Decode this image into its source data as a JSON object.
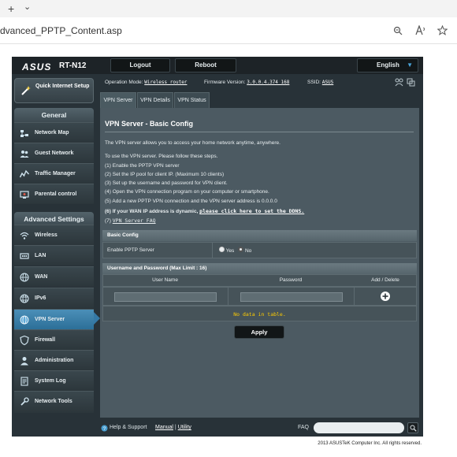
{
  "browser": {
    "url_text": "dvanced_PPTP_Content.asp",
    "new_tab_glyph": "+",
    "dropdown_glyph": "⌄"
  },
  "header": {
    "logo": "ASUS",
    "model": "RT-N12",
    "logout": "Logout",
    "reboot": "Reboot",
    "language": "English"
  },
  "sidebar": {
    "quick_setup": "Quick Internet Setup",
    "general_title": "General",
    "general_items": [
      {
        "label": "Network Map",
        "icon": "network-map-icon"
      },
      {
        "label": "Guest Network",
        "icon": "guest-network-icon"
      },
      {
        "label": "Traffic Manager",
        "icon": "traffic-manager-icon"
      },
      {
        "label": "Parental control",
        "icon": "parental-control-icon"
      }
    ],
    "advanced_title": "Advanced Settings",
    "advanced_items": [
      {
        "label": "Wireless",
        "icon": "wireless-icon"
      },
      {
        "label": "LAN",
        "icon": "lan-icon"
      },
      {
        "label": "WAN",
        "icon": "wan-icon"
      },
      {
        "label": "IPv6",
        "icon": "ipv6-icon"
      },
      {
        "label": "VPN Server",
        "icon": "vpn-server-icon"
      },
      {
        "label": "Firewall",
        "icon": "firewall-icon"
      },
      {
        "label": "Administration",
        "icon": "administration-icon"
      },
      {
        "label": "System Log",
        "icon": "system-log-icon"
      },
      {
        "label": "Network Tools",
        "icon": "network-tools-icon"
      }
    ]
  },
  "status": {
    "op_mode_label": "Operation Mode:",
    "op_mode_value": "Wireless router",
    "firmware_label": "Firmware Version:",
    "firmware_value": "3.0.0.4.374_168",
    "ssid_label": "SSID:",
    "ssid_value": "ASUS"
  },
  "tabs": [
    "VPN Server",
    "VPN Details",
    "VPN Status"
  ],
  "content": {
    "title": "VPN Server - Basic Config",
    "intro": "The VPN server allows you to access your home network anytime, anywhere.",
    "steps_intro": "To use the VPN server. Please follow these steps.",
    "step1": "(1) Enable the PPTP VPN server",
    "step2": "(2) Set the IP pool for client IP. (Maximum 10 clients)",
    "step3": "(3) Set up the username and password for VPN client.",
    "step4": "(4) Open the VPN connection program on your computer or smartphone.",
    "step5": "(5) Add a new PPTP VPN connection and the VPN server address is 0.0.0.0",
    "step6": "(6) If your WAN IP address is dynamic,",
    "step6_link": "please click here to set the DDNS.",
    "step7": "(7)",
    "step7_link": "VPN Server FAQ"
  },
  "basic_config": {
    "header": "Basic Config",
    "enable_label": "Enable PPTP Server",
    "yes": "Yes",
    "no": "No",
    "selected": "No"
  },
  "user_table": {
    "header": "Username and Password (Max Limit : 16)",
    "col_user": "User Name",
    "col_pass": "Password",
    "col_action": "Add / Delete",
    "no_data": "No data in table."
  },
  "apply_button": "Apply",
  "footer": {
    "help": "Help & Support",
    "manual": "Manual",
    "separator": "|",
    "utility": "Utility",
    "faq": "FAQ",
    "copyright": "2013 ASUSTeK Computer Inc. All rights reserved."
  },
  "colors": {
    "panel": "#4c5a62",
    "frame": "#283238",
    "active_nav": "#3579a6",
    "warning_text": "#ffcc00"
  }
}
